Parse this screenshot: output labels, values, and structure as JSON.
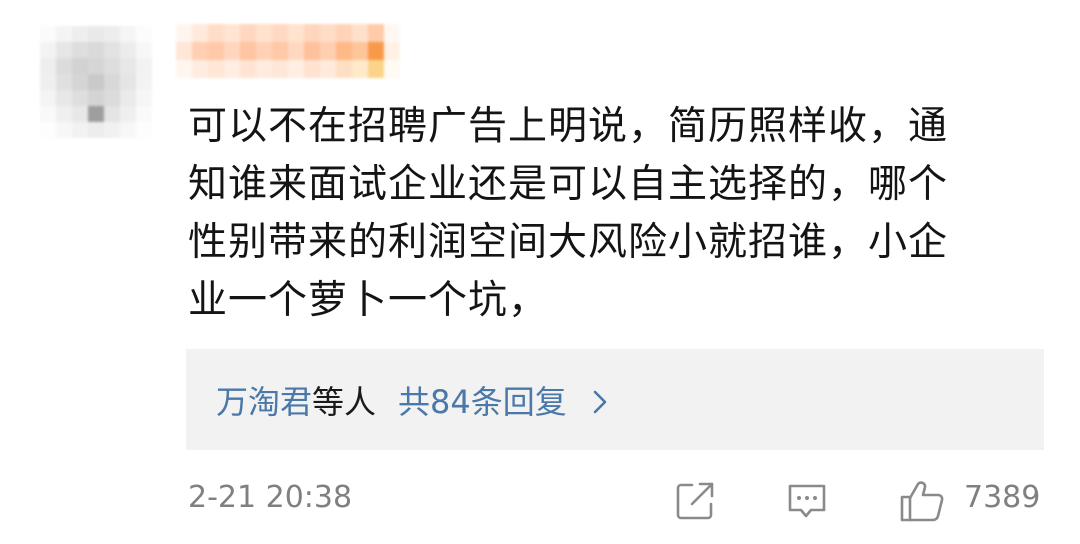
{
  "comment": {
    "lines": [
      "可以不在招聘广告上明说，简历照样收，通",
      "知谁来面试企业还是可以自主选择的，哪个",
      "性别带来的利润空间大风险小就招谁，小企",
      "业一个萝卜一个坑，"
    ],
    "replies": {
      "users": "万淘君",
      "etc": "等人",
      "count_text": "共84条回复",
      "chevron_icon": "chevron-right-icon"
    },
    "timestamp": "2-21 20:38",
    "actions": {
      "share_icon": "share-icon",
      "comment_icon": "comment-icon",
      "like_icon": "thumbs-up-icon",
      "like_count": "7389"
    }
  },
  "colors": {
    "link": "#4a78a8",
    "text": "#141414",
    "muted": "#808080",
    "reply_bg": "#f2f2f2"
  }
}
